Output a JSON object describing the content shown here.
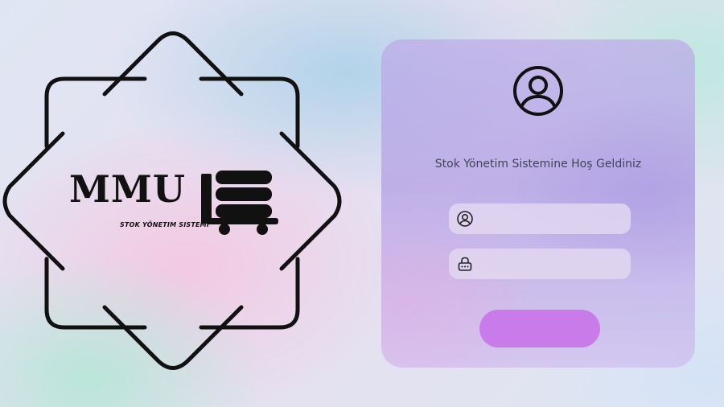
{
  "logo": {
    "brand": "MMU",
    "tagline": "STOK YÖNETIM SISTEMI"
  },
  "login": {
    "welcome_text": "Stok Yönetim Sistemine Hoş Geldiniz",
    "username": {
      "value": "",
      "placeholder": ""
    },
    "password": {
      "value": "",
      "placeholder": ""
    },
    "submit_label": ""
  },
  "colors": {
    "button": "#c97be9",
    "card": "#b9a8e6",
    "ink": "#111111"
  }
}
